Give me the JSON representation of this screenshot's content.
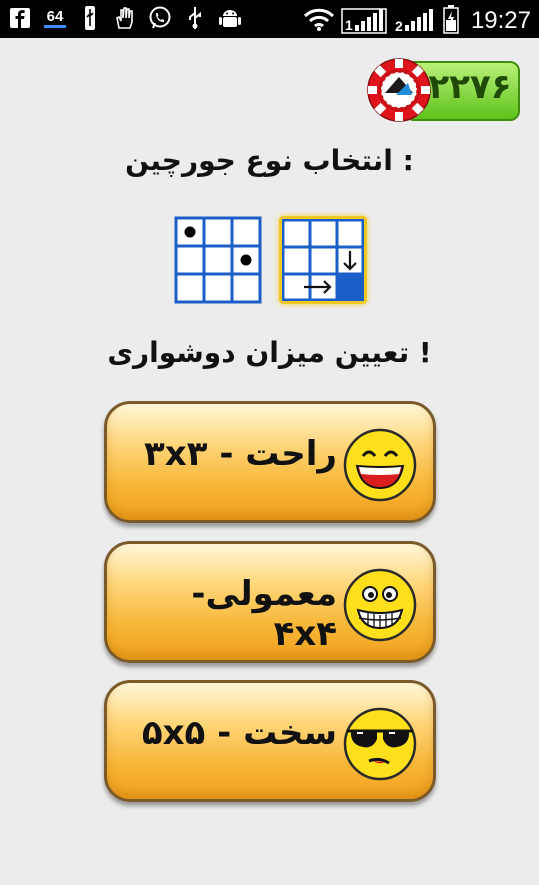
{
  "status_bar": {
    "left_icons": [
      "facebook-icon",
      "badge-64-icon",
      "usb-icon",
      "hand-icon",
      "viber-icon",
      "usb-icon",
      "android-icon"
    ],
    "badge_text": "64",
    "time": "19:27"
  },
  "coins": {
    "count": "۲۲۷۶"
  },
  "title_puzzle_type": "انتخاب نوع جورچین :",
  "title_difficulty": "تعیین میزان دوشواری !",
  "difficulty": [
    {
      "label": "راحت - ۳x۳",
      "face": "laughing"
    },
    {
      "label": "معمولی- ۴x۴",
      "face": "grinning"
    },
    {
      "label": "سخت - ۵x۵",
      "face": "sunglasses"
    }
  ],
  "colors": {
    "grid_blue": "#1a5ec8",
    "coin_green": "#5fc31a",
    "button_orange": "#f7b637",
    "face_yellow": "#ffe01a"
  }
}
